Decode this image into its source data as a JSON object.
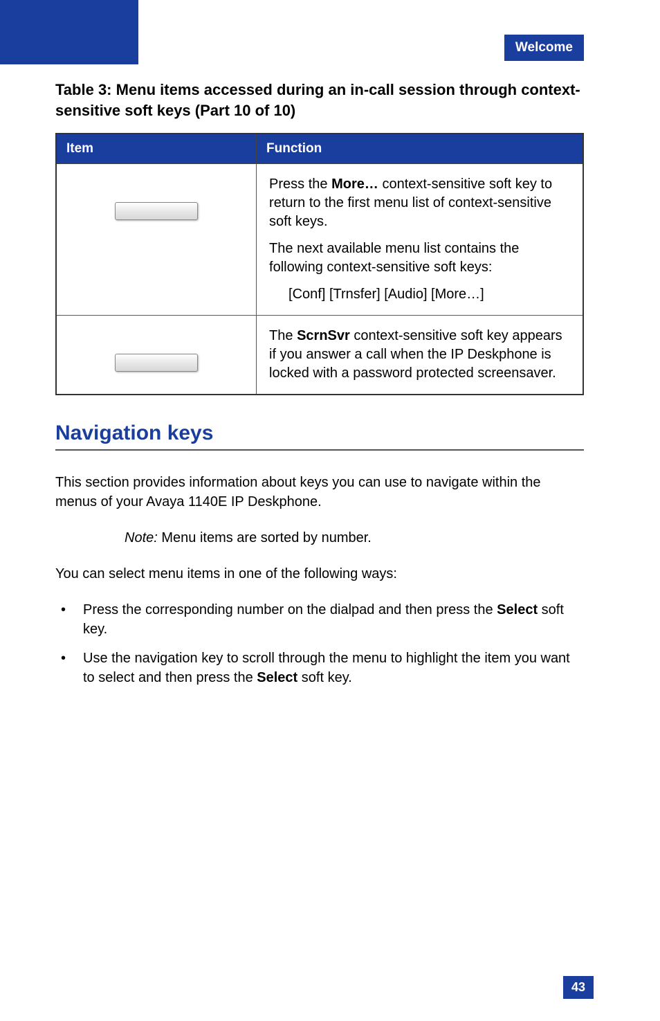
{
  "header": {
    "section": "Welcome"
  },
  "table": {
    "title": "Table 3: Menu items accessed during an in-call session through context-sensitive soft keys (Part 10 of 10)",
    "head": {
      "col1": "Item",
      "col2": "Function"
    },
    "rows": [
      {
        "desc": {
          "p1a": "Press the ",
          "p1_bold": "More…",
          "p1b": " context-sensitive soft key to return to the first menu list of context-sensitive soft keys.",
          "p2": "The next available menu list contains the following context-sensitive soft keys:",
          "p3": "[Conf] [Trnsfer] [Audio] [More…]"
        }
      },
      {
        "desc": {
          "p1a": "The ",
          "p1_bold": "ScrnSvr",
          "p1b": " context-sensitive soft key appears if you answer a call when the IP Deskphone is locked with a password protected screensaver."
        }
      }
    ]
  },
  "heading": "Navigation keys",
  "intro": "This section provides information about keys you can use to navigate within the menus of your Avaya 1140E IP Deskphone.",
  "note": {
    "label": "Note:",
    "text": " Menu items are sorted by number."
  },
  "ways_intro": "You can select menu items in one of the following ways:",
  "ways": [
    {
      "a": "Press the corresponding number on the dialpad and then press the ",
      "bold": "Select",
      "b": " soft key."
    },
    {
      "a": "Use the navigation key to scroll through the menu to highlight the item you want to select and then press the ",
      "bold": "Select",
      "b": " soft key."
    }
  ],
  "page_number": "43"
}
